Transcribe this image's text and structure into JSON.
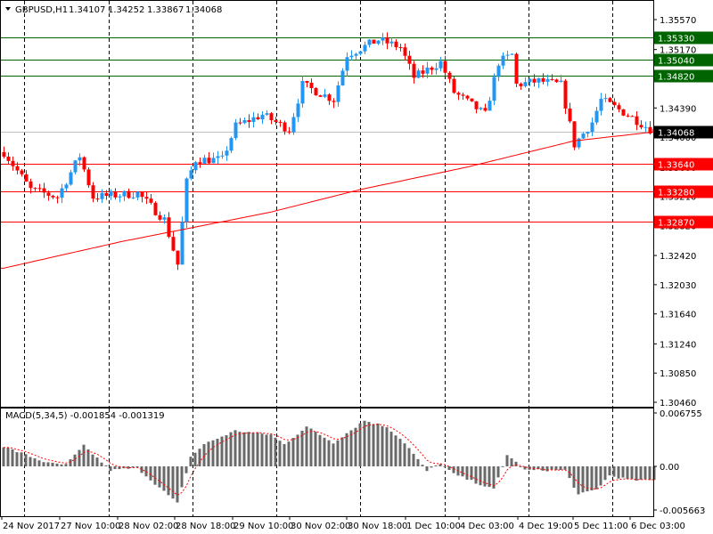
{
  "header": {
    "symbol": "GBPUSD,H1",
    "open": "1.34107",
    "high": "1.34252",
    "low": "1.33867",
    "close": "1.34068"
  },
  "colors": {
    "bull": "#2196f3",
    "bear": "#ff0000",
    "ma": "#ff0000",
    "green_level": "#006400",
    "red_level": "#ff0000",
    "macd_hist": "#696969",
    "macd_signal": "#ff0000"
  },
  "chart_data": [
    {
      "type": "candlestick",
      "title": "GBPUSD,H1",
      "ylim": [
        1.3046,
        1.3557
      ],
      "y_ticks": [
        "1.35570",
        "1.35170",
        "1.34390",
        "1.34000",
        "1.33600",
        "1.33210",
        "1.32820",
        "1.32420",
        "1.32030",
        "1.31640",
        "1.31240",
        "1.30850",
        "1.30460"
      ],
      "price_levels": [
        {
          "value": "1.35330",
          "color": "green"
        },
        {
          "value": "1.35040",
          "color": "green"
        },
        {
          "value": "1.34820",
          "color": "green"
        },
        {
          "value": "1.34068",
          "color": "current"
        },
        {
          "value": "1.33640",
          "color": "red"
        },
        {
          "value": "1.33280",
          "color": "red"
        },
        {
          "value": "1.32870",
          "color": "red"
        }
      ],
      "approx_close_keypoints": [
        [
          0,
          1.338
        ],
        [
          6,
          1.333
        ],
        [
          12,
          1.332
        ],
        [
          17,
          1.3375
        ],
        [
          20,
          1.332
        ],
        [
          30,
          1.3325
        ],
        [
          36,
          1.329
        ],
        [
          39,
          1.323
        ],
        [
          41,
          1.334
        ],
        [
          43,
          1.337
        ],
        [
          49,
          1.337
        ],
        [
          52,
          1.3415
        ],
        [
          58,
          1.343
        ],
        [
          64,
          1.341
        ],
        [
          67,
          1.347
        ],
        [
          74,
          1.345
        ],
        [
          77,
          1.351
        ],
        [
          84,
          1.353
        ],
        [
          89,
          1.352
        ],
        [
          92,
          1.348
        ],
        [
          98,
          1.35
        ],
        [
          101,
          1.346
        ],
        [
          108,
          1.343
        ],
        [
          111,
          1.35
        ],
        [
          114,
          1.351
        ],
        [
          115,
          1.347
        ],
        [
          120,
          1.3475
        ],
        [
          125,
          1.347
        ],
        [
          128,
          1.339
        ],
        [
          132,
          1.342
        ],
        [
          134,
          1.345
        ],
        [
          140,
          1.343
        ],
        [
          146,
          1.3407
        ]
      ],
      "ma_keypoints": [
        [
          0,
          1.3225
        ],
        [
          26,
          1.326
        ],
        [
          60,
          1.33
        ],
        [
          80,
          1.333
        ],
        [
          104,
          1.336
        ],
        [
          128,
          1.3395
        ],
        [
          146,
          1.3407
        ]
      ],
      "x_tick_labels": [
        "24 Nov 2017",
        "27 Nov 10:00",
        "28 Nov 02:00",
        "28 Nov 18:00",
        "29 Nov 10:00",
        "30 Nov 02:00",
        "30 Nov 18:00",
        "1 Dec 10:00",
        "4 Dec 03:00",
        "4 Dec 19:00",
        "5 Dec 11:00",
        "6 Dec 03:00"
      ]
    },
    {
      "type": "bar",
      "title": "MACD(5,34,5) -0.001854 -0.001319",
      "ylim": [
        -0.005663,
        0.006755
      ],
      "y_ticks": [
        "0.006755",
        "0.00",
        "-0.005663"
      ],
      "hist_keypoints": [
        [
          0,
          0.0025
        ],
        [
          10,
          0.0004
        ],
        [
          14,
          0.0002
        ],
        [
          18,
          0.0026
        ],
        [
          24,
          -0.0005
        ],
        [
          30,
          -0.0002
        ],
        [
          39,
          -0.0048
        ],
        [
          42,
          0.0012
        ],
        [
          45,
          0.0028
        ],
        [
          52,
          0.0045
        ],
        [
          60,
          0.004
        ],
        [
          63,
          0.0028
        ],
        [
          68,
          0.005
        ],
        [
          74,
          0.003
        ],
        [
          81,
          0.0058
        ],
        [
          86,
          0.005
        ],
        [
          90,
          0.003
        ],
        [
          95,
          -0.0006
        ],
        [
          98,
          0.0004
        ],
        [
          101,
          -0.001
        ],
        [
          110,
          -0.003
        ],
        [
          113,
          0.0015
        ],
        [
          117,
          -0.0005
        ],
        [
          126,
          -0.0005
        ],
        [
          129,
          -0.0037
        ],
        [
          133,
          -0.003
        ],
        [
          136,
          -0.0012
        ],
        [
          141,
          -0.0018
        ],
        [
          146,
          -0.0018
        ]
      ]
    }
  ]
}
